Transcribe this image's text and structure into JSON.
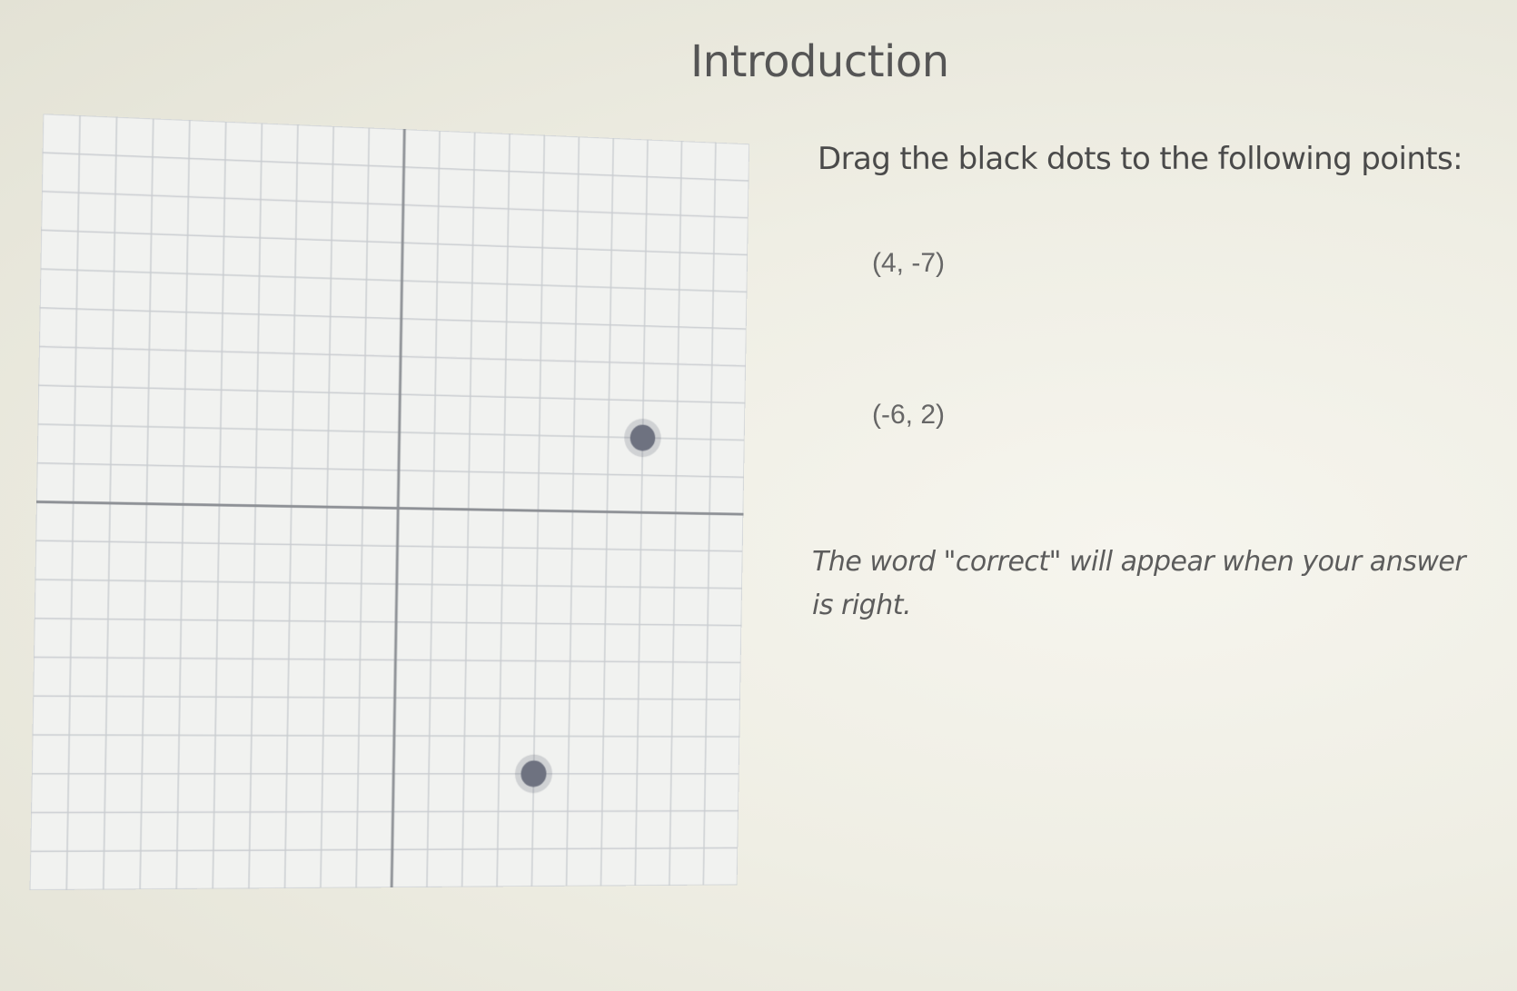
{
  "page": {
    "title": "Introduction"
  },
  "instructions": {
    "prompt": "Drag the black dots to the following points:",
    "points": [
      "(4, -7)",
      "(-6, 2)"
    ],
    "feedback_note": "The word \"correct\" will appear when your answer is right."
  },
  "graph": {
    "x_range": [
      -10,
      10
    ],
    "y_range": [
      -10,
      10
    ],
    "grid_step": 1,
    "draggable_dots": [
      {
        "name": "dot-1",
        "x": 7,
        "y": 2
      },
      {
        "name": "dot-2",
        "x": 4,
        "y": -7
      }
    ]
  },
  "colors": {
    "grid_line": "#c9ccd0",
    "axis_line": "#8e9196",
    "dot_fill": "#6e7280",
    "grid_background": "#f1f2f0"
  }
}
